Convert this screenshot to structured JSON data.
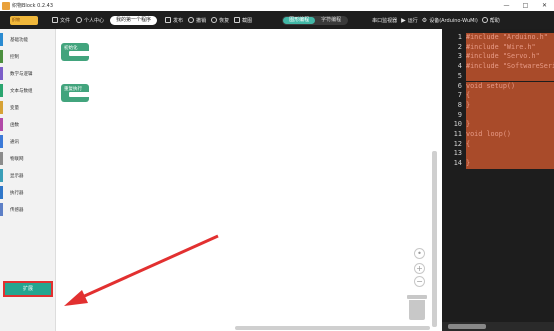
{
  "window": {
    "title": "织物Block 0.2.43",
    "controls": [
      "—",
      "□",
      "✕"
    ]
  },
  "toolbar": {
    "logo_text": "织物",
    "file": "文件",
    "personal_center": "个人中心",
    "project_name": "我的第一个程序",
    "publish": "发布",
    "undo": "撤销",
    "redo": "恢复",
    "screenshot": "截图",
    "graphic_mode": "图形编程",
    "code_mode": "字符编程",
    "serial_monitor": "串口监视器",
    "run": "运行",
    "device": "设备(Arduino-WuMi)",
    "help": "帮助"
  },
  "sidebar": {
    "categories": [
      {
        "label": "基础功能",
        "color": "#2a8bd1"
      },
      {
        "label": "控制",
        "color": "#4b8f3e"
      },
      {
        "label": "数学与逻辑",
        "color": "#7b5ec8"
      },
      {
        "label": "文本与数组",
        "color": "#2aa56f"
      },
      {
        "label": "变量",
        "color": "#d7a235"
      },
      {
        "label": "函数",
        "color": "#b24aa8"
      },
      {
        "label": "通讯",
        "color": "#3c7ad8"
      },
      {
        "label": "物联网",
        "color": "#8c8c8c"
      },
      {
        "label": "显示器",
        "color": "#3b9fb8"
      },
      {
        "label": "执行器",
        "color": "#2f77c9"
      },
      {
        "label": "传感器",
        "color": "#5d7fc6"
      }
    ],
    "expand_label": "扩展"
  },
  "workspace": {
    "blocks": [
      {
        "label": "初始化"
      },
      {
        "label": "重复执行"
      }
    ],
    "zoom": [
      "+",
      "−"
    ]
  },
  "code": {
    "lines": [
      {
        "n": "1",
        "text": "#include \"Arduino.h\""
      },
      {
        "n": "2",
        "text": "#include \"Wire.h\""
      },
      {
        "n": "3",
        "text": "#include \"Servo.h\""
      },
      {
        "n": "4",
        "text": "#include \"SoftwareSerial.h\""
      },
      {
        "n": "5",
        "text": ""
      },
      {
        "n": "6",
        "text": "void setup()"
      },
      {
        "n": "7",
        "text": "{"
      },
      {
        "n": "8",
        "text": "}"
      },
      {
        "n": "9",
        "text": ""
      },
      {
        "n": "10",
        "text": "}"
      },
      {
        "n": "11",
        "text": "void loop()"
      },
      {
        "n": "12",
        "text": "{"
      },
      {
        "n": "13",
        "text": ""
      },
      {
        "n": "14",
        "text": "}"
      }
    ]
  }
}
